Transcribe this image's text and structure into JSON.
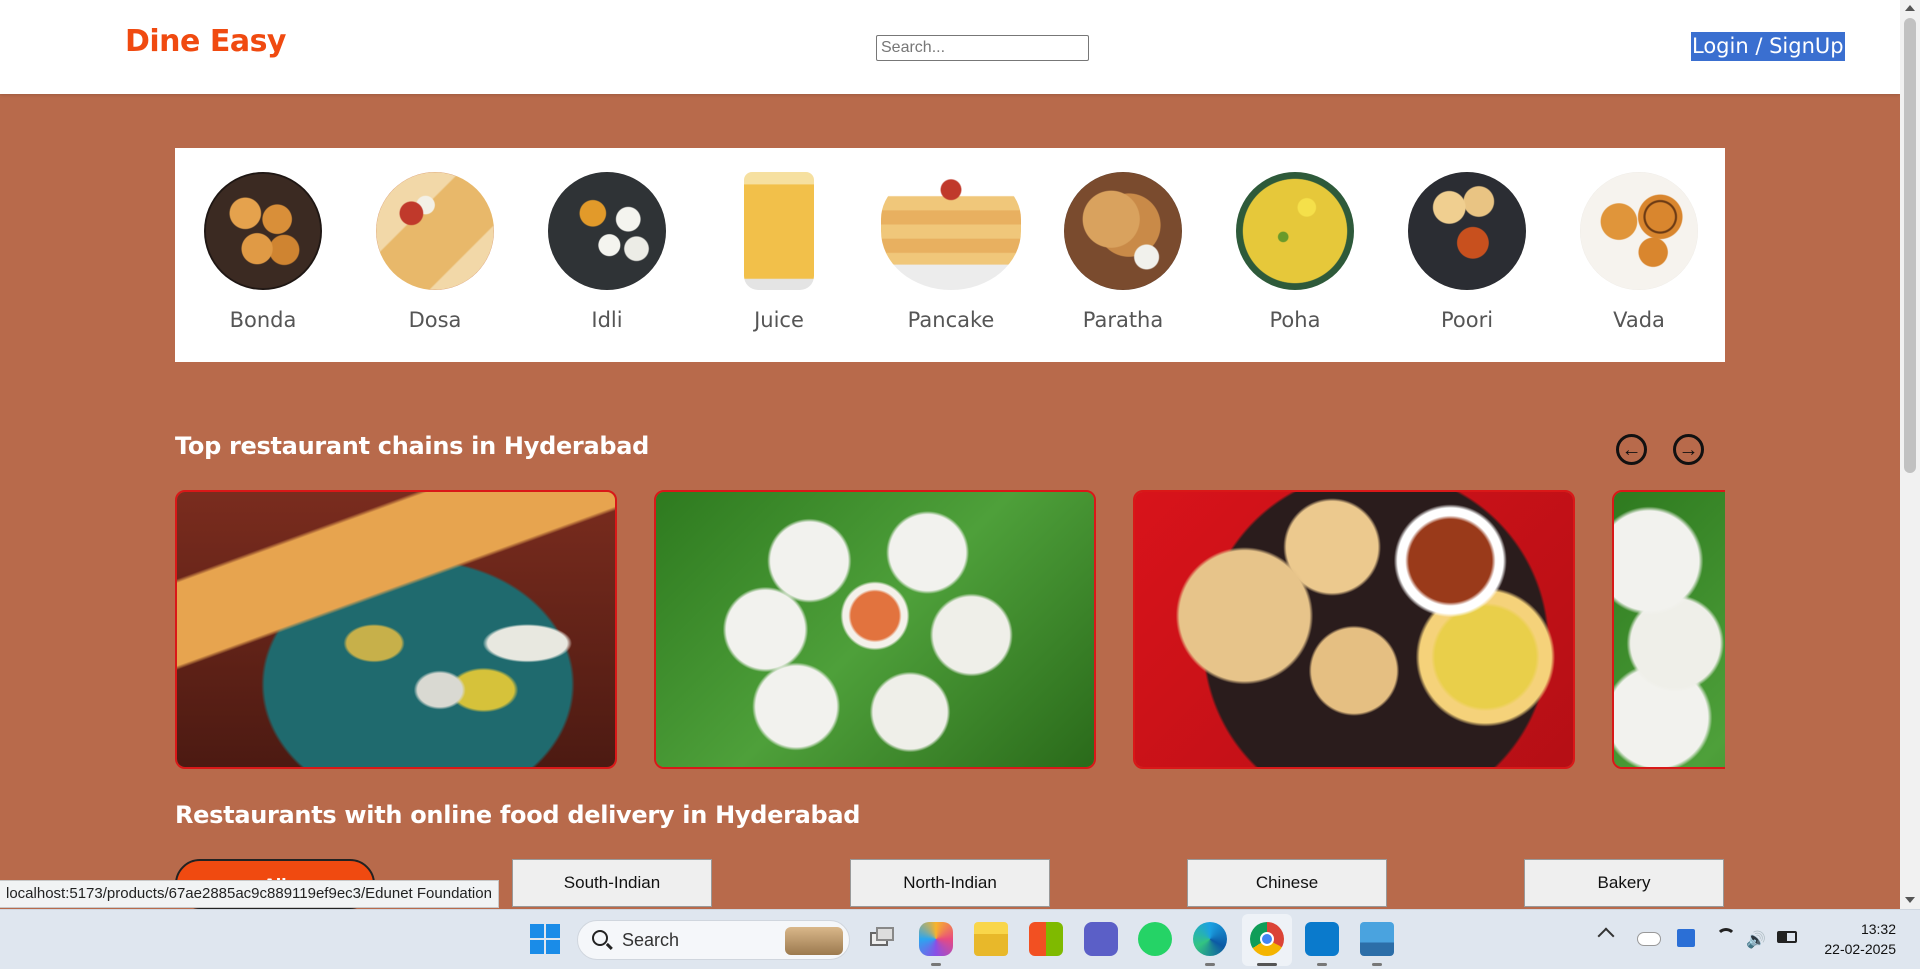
{
  "app": {
    "brand": "Dine Easy",
    "search_placeholder": "Search...",
    "login_label": "Login / SignUp"
  },
  "categories": [
    {
      "label": "Bonda"
    },
    {
      "label": "Dosa"
    },
    {
      "label": "Idli"
    },
    {
      "label": "Juice"
    },
    {
      "label": "Pancake"
    },
    {
      "label": "Paratha"
    },
    {
      "label": "Poha"
    },
    {
      "label": "Poori"
    },
    {
      "label": "Vada"
    }
  ],
  "top_chains": {
    "title": "Top restaurant chains in Hyderabad",
    "prev_icon": "arrow-left-circle-icon",
    "next_icon": "arrow-right-circle-icon"
  },
  "online_delivery": {
    "title": "Restaurants with online food delivery in Hyderabad",
    "filters": [
      "All",
      "South-Indian",
      "North-Indian",
      "Chinese",
      "Bakery"
    ]
  },
  "browser_status": {
    "url": "localhost:5173/products/67ae2885ac9c889119ef9ec3/Edunet Foundation"
  },
  "taskbar": {
    "search_label": "Search",
    "time": "13:32",
    "date": "22-02-2025"
  },
  "colors": {
    "page_bg": "#b86a4b",
    "brand": "#f04a10",
    "card_border": "#d91818",
    "login_highlight": "#3a6fd0"
  }
}
